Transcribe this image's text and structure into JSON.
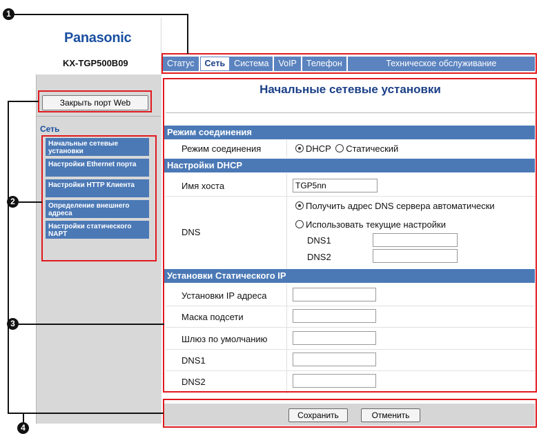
{
  "brand": "Panasonic",
  "model": "KX-TGP500B09",
  "tabs": [
    {
      "label": "Статус"
    },
    {
      "label": "Сеть"
    },
    {
      "label": "Система"
    },
    {
      "label": "VoIP"
    },
    {
      "label": "Телефон"
    },
    {
      "label": "Техническое обслуживание"
    }
  ],
  "sidebar": {
    "close_web_button": "Закрыть порт Web",
    "section_title": "Сеть",
    "items": [
      {
        "label": "Начальные сетевые установки"
      },
      {
        "label": "Настройки Ethernet порта"
      },
      {
        "label": "Настройки HTTP Клиента"
      },
      {
        "label": "Определение внешнего адреса"
      },
      {
        "label": "Настройки статического NAPT"
      }
    ]
  },
  "page_title": "Начальные сетевые установки",
  "connection_mode": {
    "header": "Режим соединения",
    "label": "Режим соединения",
    "options": [
      "DHCP",
      "Статический"
    ],
    "selected": "DHCP"
  },
  "dhcp": {
    "header": "Настройки DHCP",
    "hostname_label": "Имя хоста",
    "hostname_value": "TGP5nn",
    "dns_label": "DNS",
    "dns_auto_option": "Получить адрес DNS сервера автоматически",
    "dns_manual_option": "Использовать текущие настройки",
    "dns1_label": "DNS1",
    "dns2_label": "DNS2",
    "dns1_value": "",
    "dns2_value": ""
  },
  "static_ip": {
    "header": "Установки Статического IP",
    "fields": [
      {
        "label": "Установки IP адреса",
        "value": ""
      },
      {
        "label": "Маска подсети",
        "value": ""
      },
      {
        "label": "Шлюз по умолчанию",
        "value": ""
      },
      {
        "label": "DNS1",
        "value": ""
      },
      {
        "label": "DNS2",
        "value": ""
      }
    ]
  },
  "footer": {
    "save_label": "Сохранить",
    "cancel_label": "Отменить"
  },
  "callouts": [
    "1",
    "2",
    "3",
    "4"
  ],
  "colors": {
    "accent_blue": "#4b79b6",
    "tab_bar_blue": "#5b83bf",
    "title_blue": "#1a3f86",
    "highlight_red": "#e0191e"
  }
}
